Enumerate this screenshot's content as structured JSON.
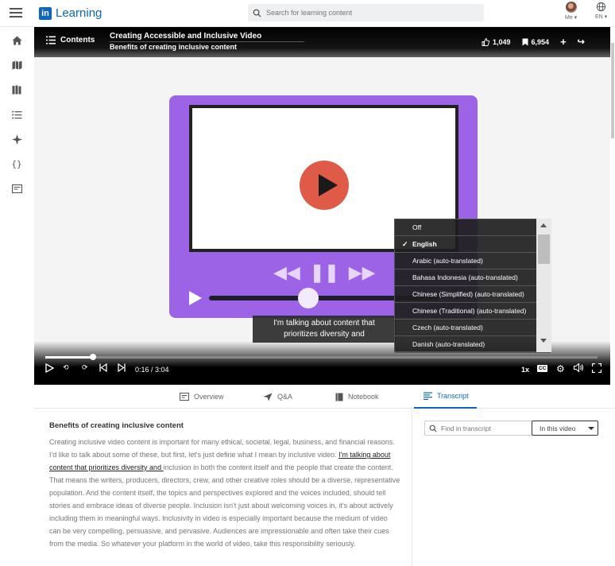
{
  "header": {
    "logo_mark": "in",
    "logo_text": "Learning",
    "search_placeholder": "Search for learning content",
    "me_label": "Me",
    "lang_label": "EN"
  },
  "sidebar": {
    "icons": [
      "home-icon",
      "map-icon",
      "library-icon",
      "list-icon",
      "sparkle-icon",
      "code-icon",
      "certificate-icon"
    ]
  },
  "player": {
    "contents_label": "Contents",
    "course_title": "Creating Accessible and Inclusive Video",
    "video_title": "Benefits of creating inclusive content",
    "likes": "1,049",
    "saves": "6,954",
    "caption_line1": "I'm talking about content that",
    "caption_line2": "prioritizes diversity and",
    "time": "0:16 / 3:04",
    "progress": 0.087,
    "speed": "1x",
    "cc": "CC",
    "captions_menu": [
      {
        "label": "Off",
        "selected": false
      },
      {
        "label": "English",
        "selected": true
      },
      {
        "label": "Arabic (auto-translated)",
        "selected": false
      },
      {
        "label": "Bahasa Indonesia (auto-translated)",
        "selected": false
      },
      {
        "label": "Chinese (Simplified) (auto-translated)",
        "selected": false
      },
      {
        "label": "Chinese (Traditional) (auto-translated)",
        "selected": false
      },
      {
        "label": "Czech (auto-translated)",
        "selected": false
      },
      {
        "label": "Danish (auto-translated)",
        "selected": false
      }
    ]
  },
  "tabs": [
    {
      "label": "Overview",
      "active": false
    },
    {
      "label": "Q&A",
      "active": false
    },
    {
      "label": "Notebook",
      "active": false
    },
    {
      "label": "Transcript",
      "active": true
    }
  ],
  "transcript": {
    "heading": "Benefits of creating inclusive content",
    "before": "Creating inclusive video content is important for many ethical, societal, legal, business, and financial reasons. I'd like to talk about some of these, but first, let's just define what I mean by inclusive video. ",
    "highlight": "I'm talking about content that prioritizes diversity and ",
    "after": "inclusion in both the content itself and the people that create the content. That means the writers, producers, directors, crew, and other creative roles should be a diverse, representative population. And the content itself, the topics and perspectives explored and the voices included, should tell stories and embrace ideas of diverse people. Inclusion isn't just about welcoming voices in, it's about actively including them in meaningful ways. Inclusivity in video is especially important because the medium of video can be very compelling, persuasive, and pervasive. Audiences are impressionable and often take their cues from the media. So whatever your platform in the world of video, take this responsibility seriously."
  },
  "find": {
    "placeholder": "Find in transcript",
    "scope_label": "In this video"
  }
}
